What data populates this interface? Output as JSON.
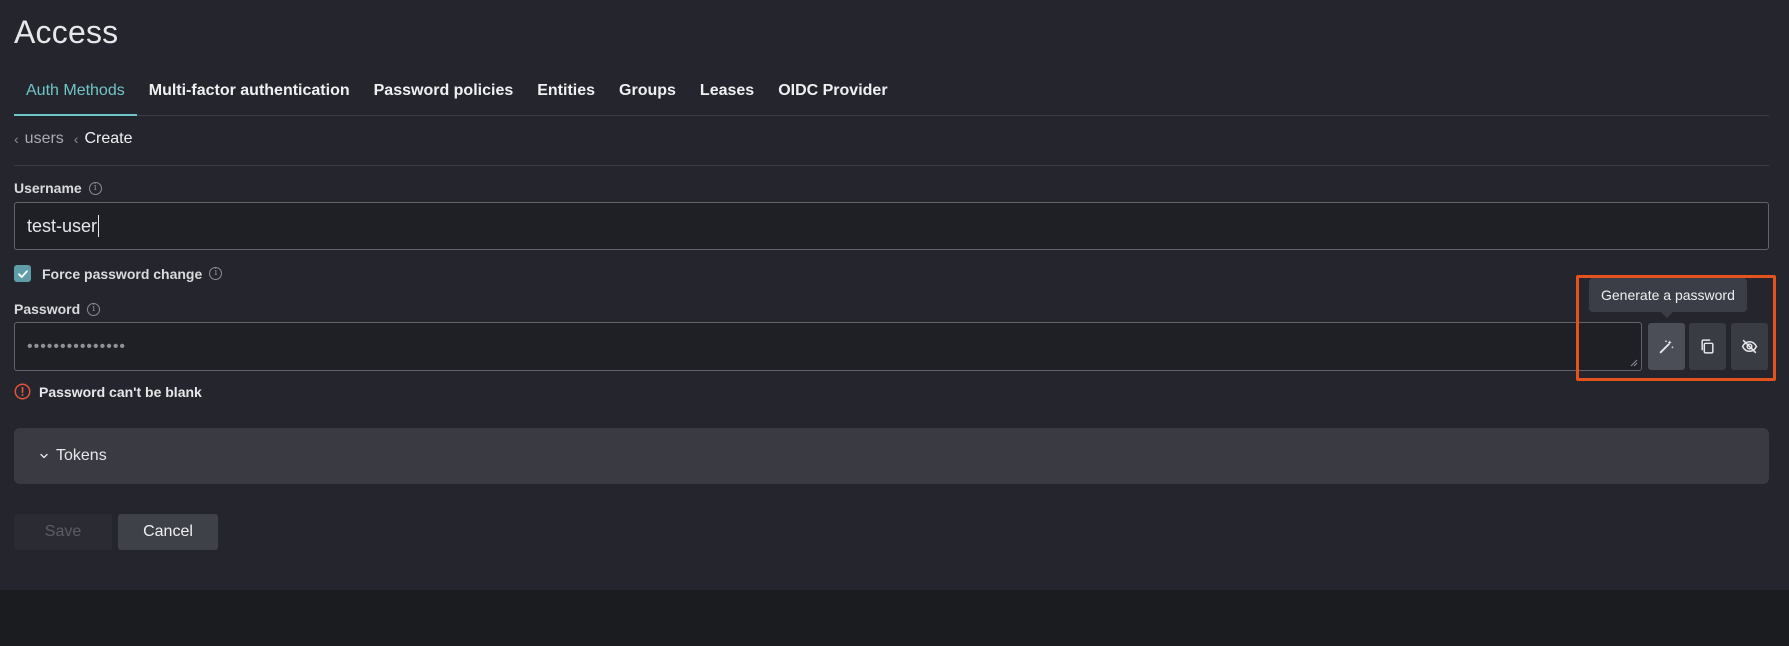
{
  "page": {
    "title": "Access"
  },
  "tabs": [
    {
      "label": "Auth Methods",
      "active": true
    },
    {
      "label": "Multi-factor authentication",
      "active": false
    },
    {
      "label": "Password policies",
      "active": false
    },
    {
      "label": "Entities",
      "active": false
    },
    {
      "label": "Groups",
      "active": false
    },
    {
      "label": "Leases",
      "active": false
    },
    {
      "label": "OIDC Provider",
      "active": false
    }
  ],
  "breadcrumb": {
    "parent": "users",
    "current": "Create"
  },
  "form": {
    "username": {
      "label": "Username",
      "value": "test-user"
    },
    "force_password_change": {
      "label": "Force password change",
      "checked": true
    },
    "password": {
      "label": "Password",
      "masked_value": "•••••••••••••••",
      "error": "Password can't be blank"
    },
    "tooltip": "Generate a password",
    "tokens": {
      "label": "Tokens",
      "expanded": false
    },
    "save_label": "Save",
    "cancel_label": "Cancel"
  },
  "colors": {
    "accent": "#6fc5c8",
    "checkbox": "#5f9ea8",
    "error": "#e5533f",
    "highlight": "#e4531e"
  },
  "icons": {
    "generate": "magic-wand-icon",
    "copy": "copy-icon",
    "visibility": "eye-off-icon"
  }
}
